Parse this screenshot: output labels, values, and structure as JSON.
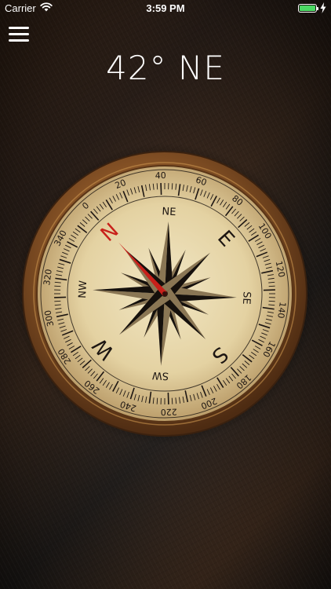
{
  "status_bar": {
    "carrier": "Carrier",
    "time": "3:59 PM",
    "battery_color": "#4cd964"
  },
  "menu": {
    "icon": "hamburger-menu-icon"
  },
  "heading": {
    "text": "42° NE"
  },
  "compass": {
    "heading_degrees": 42,
    "dial_labels": [
      "0",
      "20",
      "40",
      "60",
      "80",
      "100",
      "120",
      "140",
      "160",
      "180",
      "200",
      "220",
      "240",
      "260",
      "280",
      "300",
      "320",
      "340"
    ],
    "cardinals": {
      "n": "N",
      "e": "E",
      "s": "S",
      "w": "W"
    },
    "intercardinals": {
      "ne": "NE",
      "se": "SE",
      "sw": "SW",
      "nw": "NW"
    },
    "colors": {
      "needle": "#c8201a",
      "north_label": "#c8201a",
      "rim": "#7a4b1f",
      "face": "#e8d9ae",
      "ink": "#1d1612"
    }
  }
}
